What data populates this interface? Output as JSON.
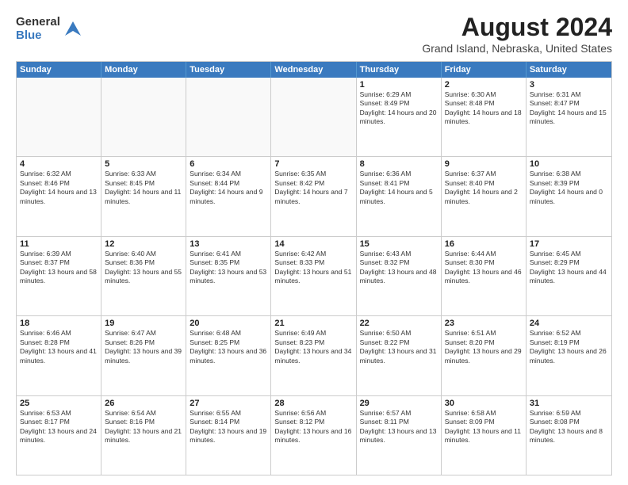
{
  "logo": {
    "general": "General",
    "blue": "Blue"
  },
  "title": "August 2024",
  "subtitle": "Grand Island, Nebraska, United States",
  "days_of_week": [
    "Sunday",
    "Monday",
    "Tuesday",
    "Wednesday",
    "Thursday",
    "Friday",
    "Saturday"
  ],
  "weeks": [
    [
      {
        "day": "",
        "empty": true
      },
      {
        "day": "",
        "empty": true
      },
      {
        "day": "",
        "empty": true
      },
      {
        "day": "",
        "empty": true
      },
      {
        "day": "1",
        "sunrise": "6:29 AM",
        "sunset": "8:49 PM",
        "daylight": "14 hours and 20 minutes."
      },
      {
        "day": "2",
        "sunrise": "6:30 AM",
        "sunset": "8:48 PM",
        "daylight": "14 hours and 18 minutes."
      },
      {
        "day": "3",
        "sunrise": "6:31 AM",
        "sunset": "8:47 PM",
        "daylight": "14 hours and 15 minutes."
      }
    ],
    [
      {
        "day": "4",
        "sunrise": "6:32 AM",
        "sunset": "8:46 PM",
        "daylight": "14 hours and 13 minutes."
      },
      {
        "day": "5",
        "sunrise": "6:33 AM",
        "sunset": "8:45 PM",
        "daylight": "14 hours and 11 minutes."
      },
      {
        "day": "6",
        "sunrise": "6:34 AM",
        "sunset": "8:44 PM",
        "daylight": "14 hours and 9 minutes."
      },
      {
        "day": "7",
        "sunrise": "6:35 AM",
        "sunset": "8:42 PM",
        "daylight": "14 hours and 7 minutes."
      },
      {
        "day": "8",
        "sunrise": "6:36 AM",
        "sunset": "8:41 PM",
        "daylight": "14 hours and 5 minutes."
      },
      {
        "day": "9",
        "sunrise": "6:37 AM",
        "sunset": "8:40 PM",
        "daylight": "14 hours and 2 minutes."
      },
      {
        "day": "10",
        "sunrise": "6:38 AM",
        "sunset": "8:39 PM",
        "daylight": "14 hours and 0 minutes."
      }
    ],
    [
      {
        "day": "11",
        "sunrise": "6:39 AM",
        "sunset": "8:37 PM",
        "daylight": "13 hours and 58 minutes."
      },
      {
        "day": "12",
        "sunrise": "6:40 AM",
        "sunset": "8:36 PM",
        "daylight": "13 hours and 55 minutes."
      },
      {
        "day": "13",
        "sunrise": "6:41 AM",
        "sunset": "8:35 PM",
        "daylight": "13 hours and 53 minutes."
      },
      {
        "day": "14",
        "sunrise": "6:42 AM",
        "sunset": "8:33 PM",
        "daylight": "13 hours and 51 minutes."
      },
      {
        "day": "15",
        "sunrise": "6:43 AM",
        "sunset": "8:32 PM",
        "daylight": "13 hours and 48 minutes."
      },
      {
        "day": "16",
        "sunrise": "6:44 AM",
        "sunset": "8:30 PM",
        "daylight": "13 hours and 46 minutes."
      },
      {
        "day": "17",
        "sunrise": "6:45 AM",
        "sunset": "8:29 PM",
        "daylight": "13 hours and 44 minutes."
      }
    ],
    [
      {
        "day": "18",
        "sunrise": "6:46 AM",
        "sunset": "8:28 PM",
        "daylight": "13 hours and 41 minutes."
      },
      {
        "day": "19",
        "sunrise": "6:47 AM",
        "sunset": "8:26 PM",
        "daylight": "13 hours and 39 minutes."
      },
      {
        "day": "20",
        "sunrise": "6:48 AM",
        "sunset": "8:25 PM",
        "daylight": "13 hours and 36 minutes."
      },
      {
        "day": "21",
        "sunrise": "6:49 AM",
        "sunset": "8:23 PM",
        "daylight": "13 hours and 34 minutes."
      },
      {
        "day": "22",
        "sunrise": "6:50 AM",
        "sunset": "8:22 PM",
        "daylight": "13 hours and 31 minutes."
      },
      {
        "day": "23",
        "sunrise": "6:51 AM",
        "sunset": "8:20 PM",
        "daylight": "13 hours and 29 minutes."
      },
      {
        "day": "24",
        "sunrise": "6:52 AM",
        "sunset": "8:19 PM",
        "daylight": "13 hours and 26 minutes."
      }
    ],
    [
      {
        "day": "25",
        "sunrise": "6:53 AM",
        "sunset": "8:17 PM",
        "daylight": "13 hours and 24 minutes."
      },
      {
        "day": "26",
        "sunrise": "6:54 AM",
        "sunset": "8:16 PM",
        "daylight": "13 hours and 21 minutes."
      },
      {
        "day": "27",
        "sunrise": "6:55 AM",
        "sunset": "8:14 PM",
        "daylight": "13 hours and 19 minutes."
      },
      {
        "day": "28",
        "sunrise": "6:56 AM",
        "sunset": "8:12 PM",
        "daylight": "13 hours and 16 minutes."
      },
      {
        "day": "29",
        "sunrise": "6:57 AM",
        "sunset": "8:11 PM",
        "daylight": "13 hours and 13 minutes."
      },
      {
        "day": "30",
        "sunrise": "6:58 AM",
        "sunset": "8:09 PM",
        "daylight": "13 hours and 11 minutes."
      },
      {
        "day": "31",
        "sunrise": "6:59 AM",
        "sunset": "8:08 PM",
        "daylight": "13 hours and 8 minutes."
      }
    ]
  ],
  "colors": {
    "header_bg": "#3a7abf",
    "header_text": "#ffffff",
    "border": "#cccccc",
    "empty_bg": "#f9f9f9",
    "shaded_bg": "#f0f0f0"
  }
}
